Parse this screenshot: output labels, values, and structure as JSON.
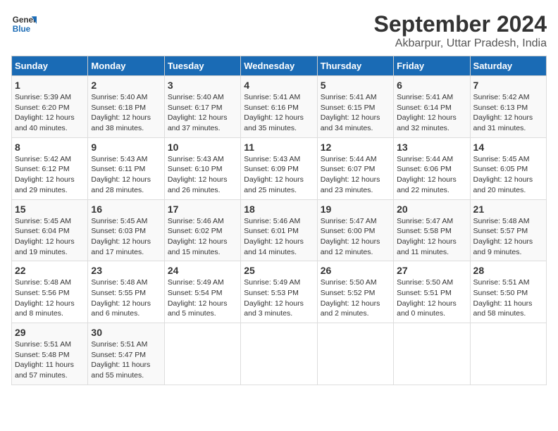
{
  "logo": {
    "line1": "General",
    "line2": "Blue"
  },
  "title": "September 2024",
  "subtitle": "Akbarpur, Uttar Pradesh, India",
  "days_of_week": [
    "Sunday",
    "Monday",
    "Tuesday",
    "Wednesday",
    "Thursday",
    "Friday",
    "Saturday"
  ],
  "weeks": [
    [
      {
        "day": "1",
        "info": "Sunrise: 5:39 AM\nSunset: 6:20 PM\nDaylight: 12 hours\nand 40 minutes."
      },
      {
        "day": "2",
        "info": "Sunrise: 5:40 AM\nSunset: 6:18 PM\nDaylight: 12 hours\nand 38 minutes."
      },
      {
        "day": "3",
        "info": "Sunrise: 5:40 AM\nSunset: 6:17 PM\nDaylight: 12 hours\nand 37 minutes."
      },
      {
        "day": "4",
        "info": "Sunrise: 5:41 AM\nSunset: 6:16 PM\nDaylight: 12 hours\nand 35 minutes."
      },
      {
        "day": "5",
        "info": "Sunrise: 5:41 AM\nSunset: 6:15 PM\nDaylight: 12 hours\nand 34 minutes."
      },
      {
        "day": "6",
        "info": "Sunrise: 5:41 AM\nSunset: 6:14 PM\nDaylight: 12 hours\nand 32 minutes."
      },
      {
        "day": "7",
        "info": "Sunrise: 5:42 AM\nSunset: 6:13 PM\nDaylight: 12 hours\nand 31 minutes."
      }
    ],
    [
      {
        "day": "8",
        "info": "Sunrise: 5:42 AM\nSunset: 6:12 PM\nDaylight: 12 hours\nand 29 minutes."
      },
      {
        "day": "9",
        "info": "Sunrise: 5:43 AM\nSunset: 6:11 PM\nDaylight: 12 hours\nand 28 minutes."
      },
      {
        "day": "10",
        "info": "Sunrise: 5:43 AM\nSunset: 6:10 PM\nDaylight: 12 hours\nand 26 minutes."
      },
      {
        "day": "11",
        "info": "Sunrise: 5:43 AM\nSunset: 6:09 PM\nDaylight: 12 hours\nand 25 minutes."
      },
      {
        "day": "12",
        "info": "Sunrise: 5:44 AM\nSunset: 6:07 PM\nDaylight: 12 hours\nand 23 minutes."
      },
      {
        "day": "13",
        "info": "Sunrise: 5:44 AM\nSunset: 6:06 PM\nDaylight: 12 hours\nand 22 minutes."
      },
      {
        "day": "14",
        "info": "Sunrise: 5:45 AM\nSunset: 6:05 PM\nDaylight: 12 hours\nand 20 minutes."
      }
    ],
    [
      {
        "day": "15",
        "info": "Sunrise: 5:45 AM\nSunset: 6:04 PM\nDaylight: 12 hours\nand 19 minutes."
      },
      {
        "day": "16",
        "info": "Sunrise: 5:45 AM\nSunset: 6:03 PM\nDaylight: 12 hours\nand 17 minutes."
      },
      {
        "day": "17",
        "info": "Sunrise: 5:46 AM\nSunset: 6:02 PM\nDaylight: 12 hours\nand 15 minutes."
      },
      {
        "day": "18",
        "info": "Sunrise: 5:46 AM\nSunset: 6:01 PM\nDaylight: 12 hours\nand 14 minutes."
      },
      {
        "day": "19",
        "info": "Sunrise: 5:47 AM\nSunset: 6:00 PM\nDaylight: 12 hours\nand 12 minutes."
      },
      {
        "day": "20",
        "info": "Sunrise: 5:47 AM\nSunset: 5:58 PM\nDaylight: 12 hours\nand 11 minutes."
      },
      {
        "day": "21",
        "info": "Sunrise: 5:48 AM\nSunset: 5:57 PM\nDaylight: 12 hours\nand 9 minutes."
      }
    ],
    [
      {
        "day": "22",
        "info": "Sunrise: 5:48 AM\nSunset: 5:56 PM\nDaylight: 12 hours\nand 8 minutes."
      },
      {
        "day": "23",
        "info": "Sunrise: 5:48 AM\nSunset: 5:55 PM\nDaylight: 12 hours\nand 6 minutes."
      },
      {
        "day": "24",
        "info": "Sunrise: 5:49 AM\nSunset: 5:54 PM\nDaylight: 12 hours\nand 5 minutes."
      },
      {
        "day": "25",
        "info": "Sunrise: 5:49 AM\nSunset: 5:53 PM\nDaylight: 12 hours\nand 3 minutes."
      },
      {
        "day": "26",
        "info": "Sunrise: 5:50 AM\nSunset: 5:52 PM\nDaylight: 12 hours\nand 2 minutes."
      },
      {
        "day": "27",
        "info": "Sunrise: 5:50 AM\nSunset: 5:51 PM\nDaylight: 12 hours\nand 0 minutes."
      },
      {
        "day": "28",
        "info": "Sunrise: 5:51 AM\nSunset: 5:50 PM\nDaylight: 11 hours\nand 58 minutes."
      }
    ],
    [
      {
        "day": "29",
        "info": "Sunrise: 5:51 AM\nSunset: 5:48 PM\nDaylight: 11 hours\nand 57 minutes."
      },
      {
        "day": "30",
        "info": "Sunrise: 5:51 AM\nSunset: 5:47 PM\nDaylight: 11 hours\nand 55 minutes."
      },
      {
        "day": "",
        "info": ""
      },
      {
        "day": "",
        "info": ""
      },
      {
        "day": "",
        "info": ""
      },
      {
        "day": "",
        "info": ""
      },
      {
        "day": "",
        "info": ""
      }
    ]
  ]
}
